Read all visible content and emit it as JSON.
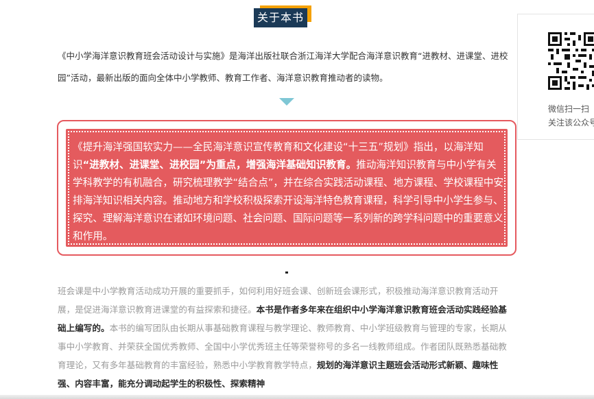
{
  "section": {
    "title": "关于本书"
  },
  "intro": {
    "text": "《中小学海洋意识教育班会活动设计与实施》是海洋出版社联合浙江海洋大学配合海洋意识教育“进教材、进课堂、进校园”活动，最新出版的面向全体中小学教师、教育工作者、海洋意识教育推动者的读物。"
  },
  "callout": {
    "part1": "《提升海洋强国软实力——全民海洋意识宣传教育和文化建设“十三五”规划》指出，以海洋知识",
    "bold1": "“进教材、进课堂、进校园”为重点，增强海洋基础知识教育。",
    "part2": "推动海洋知识教育与中小学有关学科教学的有机融合，研究梳理教学“结合点”，并在综合实践活动课程、地方课程、学校课程中安排海洋知识相关内容。推动地方和学校积极探索开设海洋特色教育课程，科学引导中小学生参与、探究、理解海洋意识在诸如环境问题、社会问题、国际问题等一系列新的跨学科问题中的重要意义和作用。"
  },
  "body": {
    "part1": "班会课是中小学教育活动成功开展的重要抓手，如何利用好班会课、创新班会课形式，积极推动海洋意识教育活动开展，是促进海洋意识教育进课堂的有益探索和捷径。",
    "bold1": "本书是作者多年来在组织中小学海洋意识教育班会活动实践经验基础上编写的。",
    "part2": "本书的编写团队由长期从事基础教育课程与教学理论、教师教育、中小学班级教育与管理的专家，长期从事中小学教育、并荣获全国优秀教师、全国中小学优秀班主任等荣誉称号的多名一线教师组成。作者团队既熟悉基础教育理论，又有多年基础教育的丰富经验，熟悉中小学教育教学特点，",
    "bold2": "规划的海洋意识主题班会活动形式新颖、趣味性强、内容丰富，能充分调动起学生的积极性、探索精神"
  },
  "qr": {
    "icon": "qr-code-icon",
    "caption_line1": "微信扫一扫",
    "caption_line2": "关注该公众号"
  }
}
